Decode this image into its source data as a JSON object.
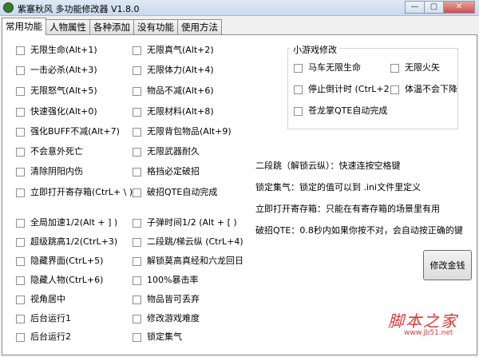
{
  "window": {
    "title": "紫塞秋风 多功能修改器  V1.8.0",
    "minimize_glyph": "—",
    "maximize_glyph": "▢",
    "close_glyph": "✕"
  },
  "tabs": [
    {
      "label": "常用功能",
      "active": true
    },
    {
      "label": "人物属性",
      "active": false
    },
    {
      "label": "各种添加",
      "active": false
    },
    {
      "label": "没有功能",
      "active": false
    },
    {
      "label": "使用方法",
      "active": false
    }
  ],
  "left_column": [
    "无限生命(Alt+1)",
    "一击必杀(Alt+3)",
    "无限怒气(Alt+5)",
    "快速强化(Alt+0)",
    "强化BUFF不减(Alt+7)",
    "不会意外死亡",
    "清除阴阳内伤",
    "立即打开寄存箱(CtrL+ \\ )",
    "全局加速1/2(Alt + ] )",
    "超级跳高1/2(CtrL+3)",
    "隐藏界面(CtrL+5)",
    "隐藏人物(CtrL+6)",
    "视角居中",
    "后台运行1",
    "后台运行2"
  ],
  "middle_column": [
    "无限真气(Alt+2)",
    "无限体力(Alt+4)",
    "物品不减(Alt+6)",
    "无限材料(Alt+8)",
    "无限背包物品(Alt+9)",
    "无限武器耐久",
    "格挡必定破招",
    "破招QTE自动完成",
    "子弹时间1/2 (Alt + [ )",
    "二段跳/梯云纵 (CtrL+4)",
    "解锁莫高真经和六龙回日",
    "100%暴击率",
    "物品皆可丢弃",
    "修改游戏难度",
    "锁定集气"
  ],
  "minigame": {
    "title": "小游戏修改",
    "items": [
      "马车无限生命",
      "无限火矢",
      "停止倒计时 (CtrL+2)",
      "体温不会下降",
      "苍龙掌QTE自动完成"
    ]
  },
  "notes": [
    "二段跳（解锁云纵）：快速连按空格键",
    "锁定集气：锁定的值可以到 .ini文件里定义",
    "立即打开寄存箱：只能在有寄存箱的场景里有用",
    "破招QTE：0.8秒内如果你按不对，会自动按正确的键"
  ],
  "money_button": "修改金钱",
  "watermark": {
    "main": "脚本之家",
    "sub": "www.jb51.net"
  }
}
